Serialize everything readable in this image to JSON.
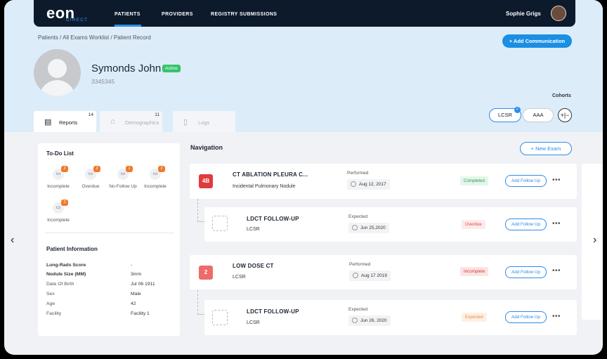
{
  "app": {
    "logo": "eon",
    "logo_sub": "DIRECT",
    "nav": [
      {
        "label": "PATIENTS"
      },
      {
        "label": "PROVIDERS"
      },
      {
        "label": "REGISTRY SUBMISSIONS"
      }
    ],
    "user_name": "Sophie Grigs"
  },
  "breadcrumb": "Patients / All Exams Worklist / Patient Record",
  "add_communication": "+ Add Communication",
  "patient": {
    "name": "Symonds John",
    "status": "Active",
    "id": "3345345"
  },
  "cohorts": {
    "label": "Cohorts",
    "chips": [
      "LCSR",
      "AAA"
    ],
    "check": "✓",
    "plus_minus": "+|−"
  },
  "tabs": [
    {
      "label": "Reports",
      "count": "14",
      "icon": "report-icon"
    },
    {
      "label": "Demographics",
      "count": "11",
      "icon": "demographics-icon"
    },
    {
      "label": "Logs",
      "count": "",
      "icon": "logs-icon"
    }
  ],
  "todo": {
    "title": "To-Do List",
    "items": [
      {
        "label": "Incomplete",
        "count": "2"
      },
      {
        "label": "Overdue",
        "count": "2"
      },
      {
        "label": "No-Follow Up",
        "count": "1"
      },
      {
        "label": "Incomplete",
        "count": "2"
      },
      {
        "label": "Incomplete",
        "count": "2"
      }
    ]
  },
  "patient_info": {
    "title": "Patient Information",
    "rows": [
      {
        "label": "Lung-Rads Score",
        "value": "-"
      },
      {
        "label": "Nodule Size (MM)",
        "value": "3mm"
      },
      {
        "label": "Date Of Birth",
        "value": "Jul 06 1911"
      },
      {
        "label": "Sex",
        "value": "Male"
      },
      {
        "label": "Age",
        "value": "42"
      },
      {
        "label": "Facility",
        "value": "Facility 1"
      }
    ]
  },
  "navigation": {
    "title": "Navigation",
    "new_exam": "+ New Exam",
    "follow_label": "Add Follow Up",
    "more": "•••",
    "exams": [
      {
        "num": "4B",
        "title": "CT ABLATION PLEURA C...",
        "sub": "Incidental Pulmonary Nodule",
        "date_label": "Performed",
        "date": "Aug 12, 2017",
        "status": "Completed",
        "num_color": "#e23b3b"
      },
      {
        "num": "",
        "title": "LDCT FOLLOW-UP",
        "sub": "LCSR",
        "date_label": "Expected",
        "date": "Jun 25,2020",
        "status": "Overdue"
      },
      {
        "num": "2",
        "title": "LOW DOSE CT",
        "sub": "LCSR",
        "date_label": "Performed",
        "date": "Aug 17 2019",
        "status": "Incomplete",
        "num_color": "#ee6b6b"
      },
      {
        "num": "",
        "title": "LDCT FOLLOW-UP",
        "sub": "LCSR",
        "date_label": "Expected",
        "date": "Jun 26, 2020",
        "status": "Expected"
      }
    ]
  },
  "arrows": {
    "left": "‹",
    "right": "›"
  }
}
